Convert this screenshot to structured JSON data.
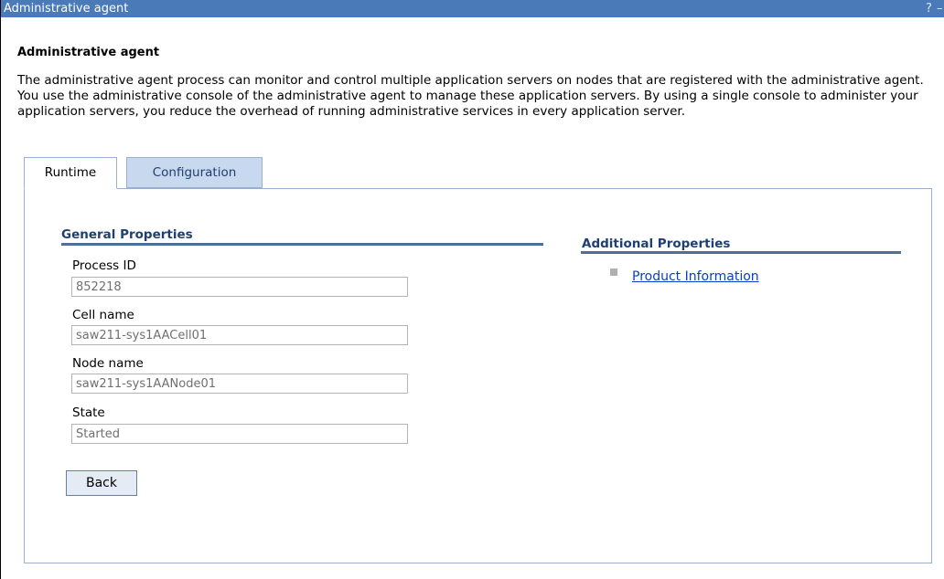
{
  "window": {
    "title": "Administrative agent",
    "help_glyph": "?",
    "minimize_glyph": "–"
  },
  "page": {
    "heading": "Administrative agent",
    "description": "The administrative agent process can monitor and control multiple application servers on nodes that are registered with the administrative agent. You use the administrative console of the administrative agent to manage these application servers. By using a single console to administer your application servers, you reduce the overhead of running administrative services in every application server."
  },
  "tabs": [
    {
      "label": "Runtime",
      "active": true
    },
    {
      "label": "Configuration",
      "active": false
    }
  ],
  "general_properties": {
    "title": "General Properties",
    "fields": [
      {
        "label": "Process ID",
        "value": "852218"
      },
      {
        "label": "Cell name",
        "value": "saw211-sys1AACell01"
      },
      {
        "label": "Node name",
        "value": "saw211-sys1AANode01"
      },
      {
        "label": "State",
        "value": "Started"
      }
    ],
    "back_label": "Back"
  },
  "additional_properties": {
    "title": "Additional Properties",
    "links": [
      {
        "label": "Product Information"
      }
    ]
  },
  "colors": {
    "titlebar": "#4a7ab8",
    "section_title": "#1f3f72",
    "link": "#0a3ec9",
    "tab_inactive": "#c8d8ee"
  }
}
